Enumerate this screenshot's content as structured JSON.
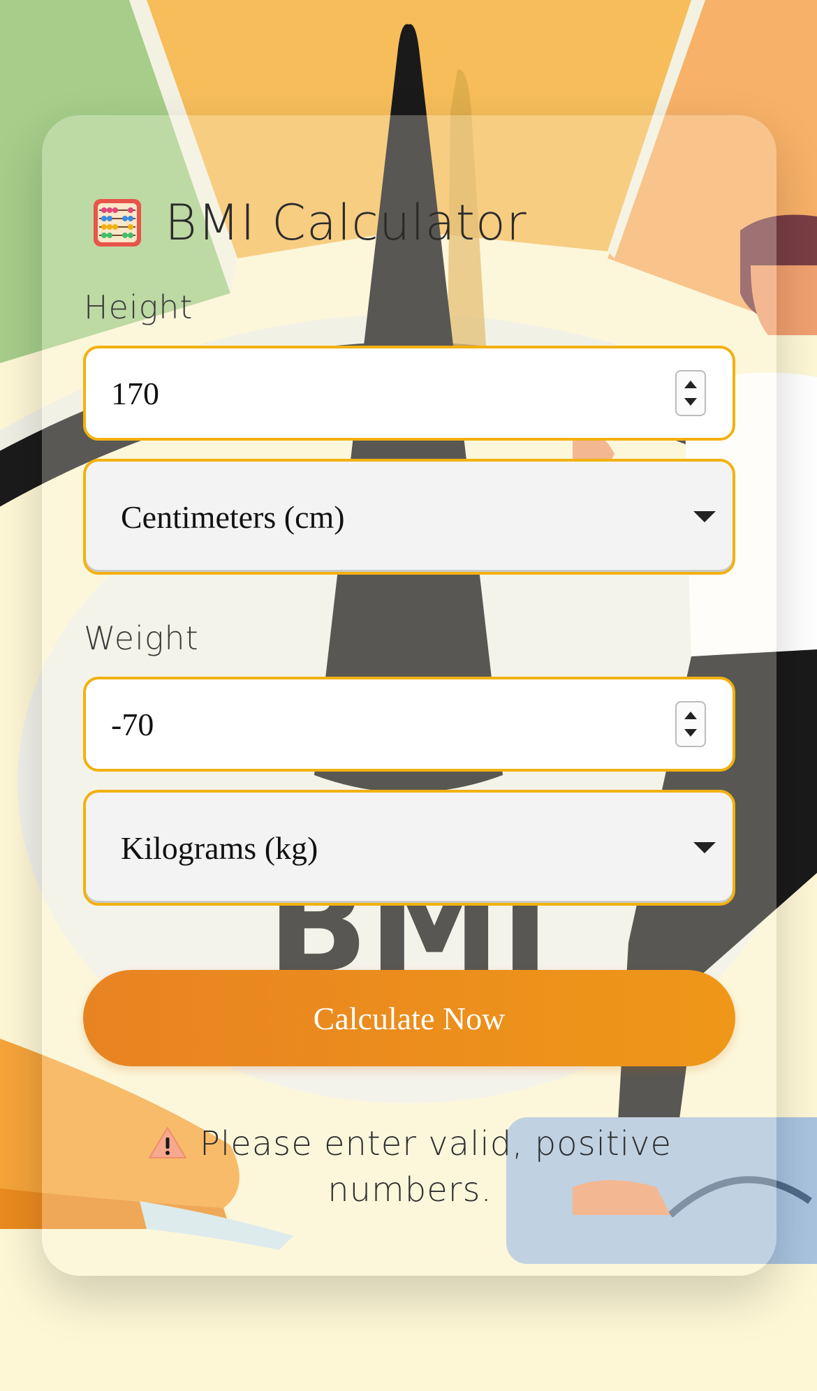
{
  "app": {
    "title": "BMI Calculator",
    "title_icon": "abacus-icon"
  },
  "height": {
    "label": "Height",
    "value": "170",
    "unit_selected": "Centimeters (cm)"
  },
  "weight": {
    "label": "Weight",
    "value": "-70",
    "unit_selected": "Kilograms (kg)"
  },
  "actions": {
    "calculate_label": "Calculate Now"
  },
  "error": {
    "icon": "warning-icon",
    "message": "Please enter valid, positive numbers."
  },
  "colors": {
    "accent_border": "#f2b10f",
    "button_start": "#e88322",
    "button_end": "#ef9718"
  },
  "background": {
    "watermark_text": "BMI"
  }
}
